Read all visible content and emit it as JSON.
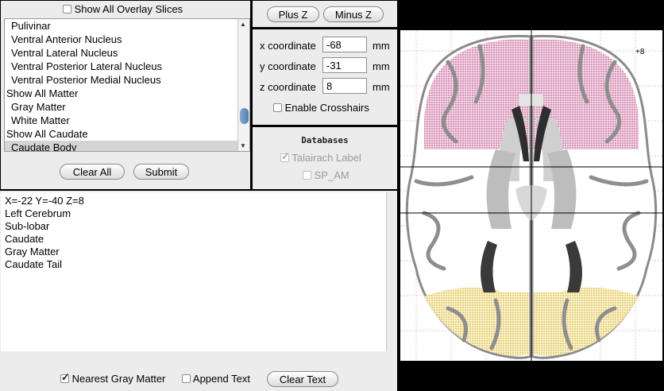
{
  "overlay": {
    "show_all_label": "Show All Overlay Slices",
    "show_all_checked": false,
    "list_items": [
      {
        "label": "Pulivinar",
        "header": false,
        "selected": false
      },
      {
        "label": "Ventral Anterior Nucleus",
        "header": false,
        "selected": false
      },
      {
        "label": "Ventral Lateral Nucleus",
        "header": false,
        "selected": false
      },
      {
        "label": "Ventral Posterior Lateral Nucleus",
        "header": false,
        "selected": false
      },
      {
        "label": "Ventral Posterior Medial Nucleus",
        "header": false,
        "selected": false
      },
      {
        "label": "Show All Matter",
        "header": true,
        "selected": false
      },
      {
        "label": "Gray Matter",
        "header": false,
        "selected": false
      },
      {
        "label": "White Matter",
        "header": false,
        "selected": false
      },
      {
        "label": "Show All Caudate",
        "header": true,
        "selected": false
      },
      {
        "label": "Caudate Body",
        "header": false,
        "selected": true
      }
    ],
    "clear_all_label": "Clear All",
    "submit_label": "Submit"
  },
  "zbuttons": {
    "plus_label": "Plus Z",
    "minus_label": "Minus Z"
  },
  "coords": {
    "x_label": "x coordinate",
    "x_value": "-68",
    "y_label": "y coordinate",
    "y_value": "-31",
    "z_label": "z coordinate",
    "z_value": "8",
    "unit": "mm",
    "crosshairs_label": "Enable Crosshairs",
    "crosshairs_checked": false
  },
  "databases": {
    "title": "Databases",
    "talairach_label": "Talairach Label",
    "talairach_checked": true,
    "spam_label": "SP_AM",
    "spam_checked": false
  },
  "output": {
    "lines": [
      "X=-22 Y=-40 Z=8",
      "Left Cerebrum",
      "Sub-lobar",
      "Caudate",
      "Gray Matter",
      "Caudate Tail"
    ]
  },
  "bottom": {
    "nearest_label": "Nearest Gray Matter",
    "nearest_checked": true,
    "append_label": "Append Text",
    "append_checked": false,
    "clear_text_label": "Clear Text"
  },
  "image": {
    "slice_label": "+8",
    "colors": {
      "upper_overlay": "#c0508a",
      "lower_overlay": "#d8b840",
      "gray": "#9a9a9a",
      "grid": "#e0a0c0"
    }
  }
}
